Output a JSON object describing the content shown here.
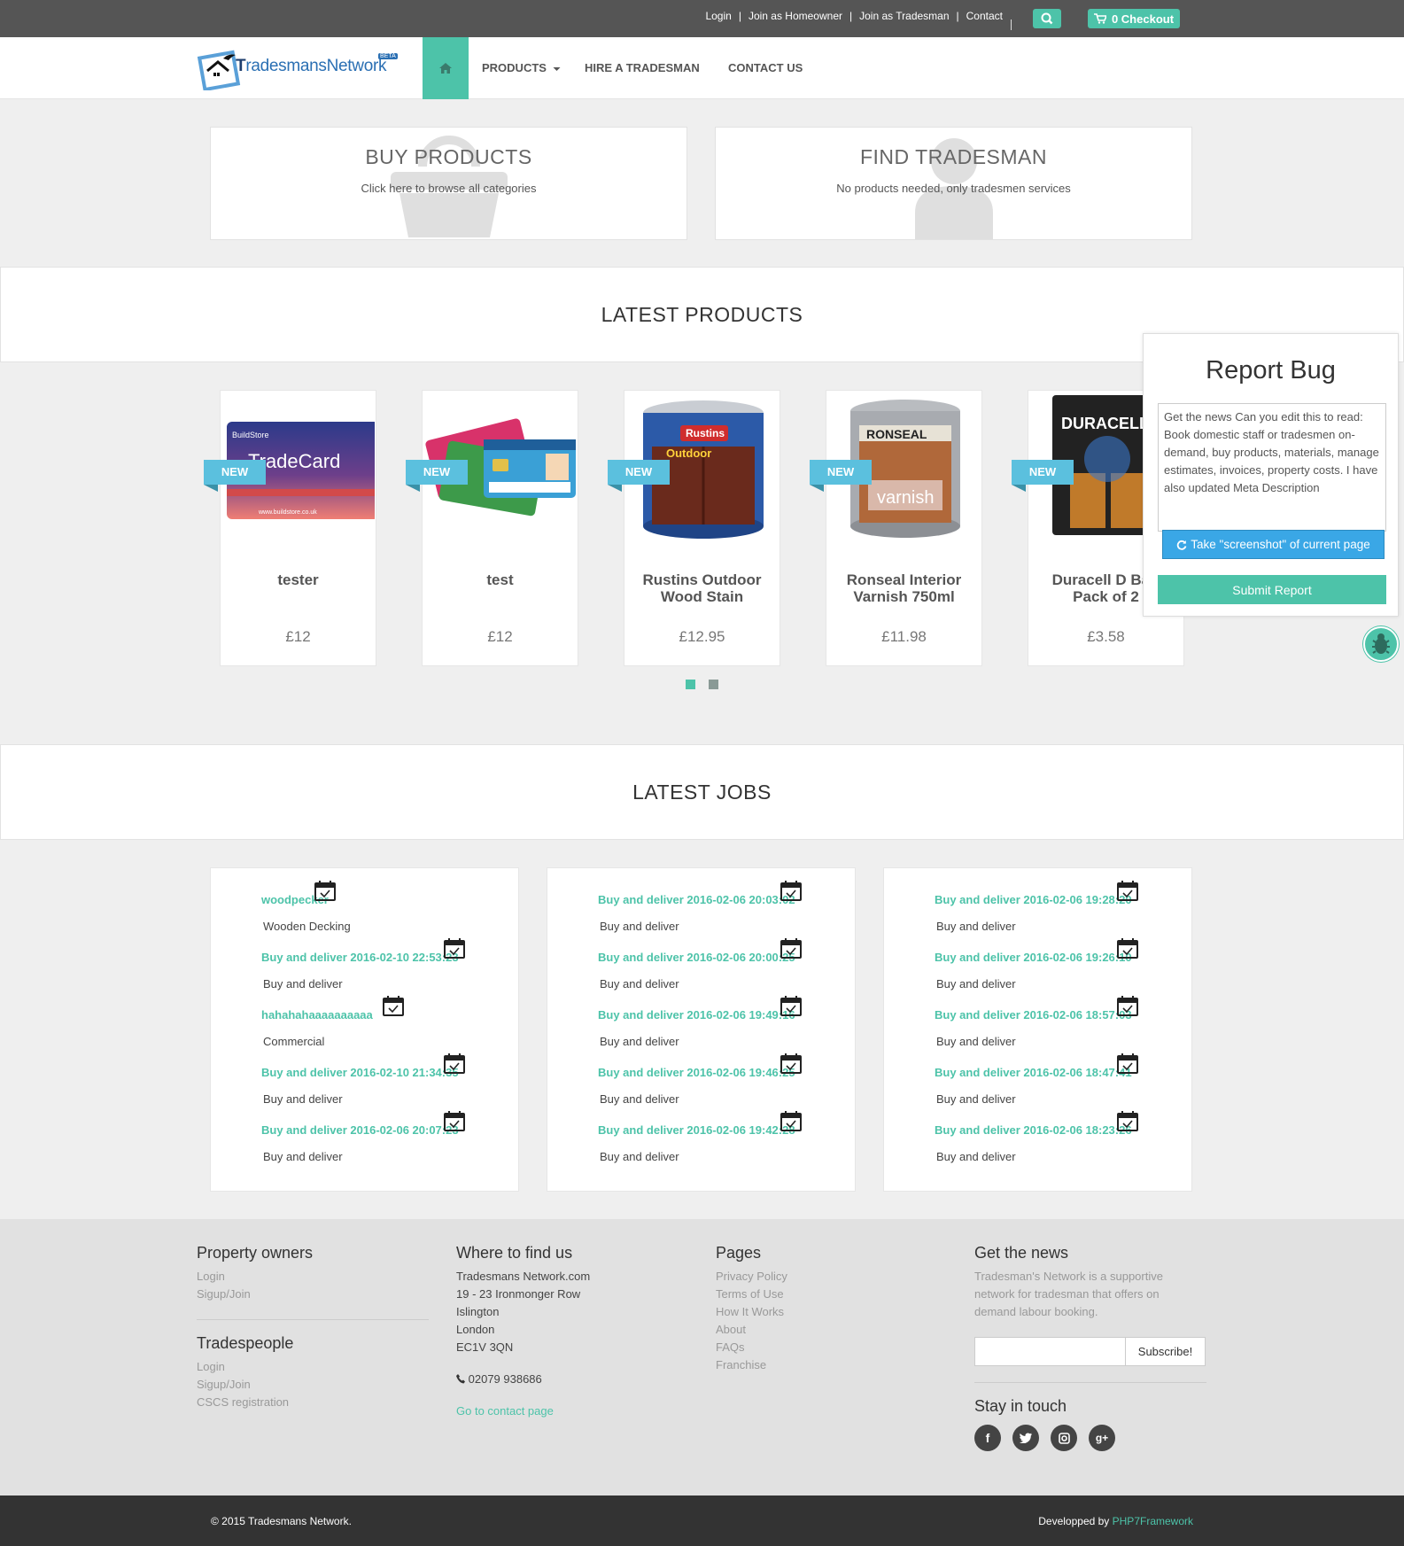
{
  "topbar": {
    "links": [
      "Login",
      "Join as Homeowner",
      "Join as Tradesman",
      "Contact"
    ],
    "checkout_label": "0 Checkout"
  },
  "logo": {
    "text": "radesmansNetwork",
    "badge": "BETA"
  },
  "nav": {
    "products": "PRODUCTS",
    "hire": "HIRE A TRADESMAN",
    "contact": "CONTACT US"
  },
  "hero": {
    "buy": {
      "title": "BUY PRODUCTS",
      "text": "Click here to browse all categories"
    },
    "find": {
      "title": "FIND TRADESMAN",
      "text": "No products needed, only tradesmen services"
    }
  },
  "latest_products": {
    "title": "LATEST PRODUCTS",
    "items": [
      {
        "name": "tester",
        "price": "£12",
        "tag": "NEW",
        "image_text": "TradeCard"
      },
      {
        "name": "test",
        "price": "£12",
        "tag": "NEW",
        "image_text": ""
      },
      {
        "name": "Rustins Outdoor Wood Stain",
        "price": "£12.95",
        "tag": "NEW",
        "image_text": "Rustins"
      },
      {
        "name": "Ronseal Interior Varnish 750ml",
        "price": "£11.98",
        "tag": "NEW",
        "image_text": "RONSEAL"
      },
      {
        "name": "Duracell D Batt Pack of 2",
        "price": "£3.58",
        "tag": "NEW",
        "image_text": "DURACELL"
      }
    ]
  },
  "report_bug": {
    "title": "Report Bug",
    "text": "Get the news Can you edit this to read: Book domestic staff or tradesmen on-demand, buy products, materials, manage estimates, invoices, property costs. I have also updated Meta Description",
    "screenshot_label": "Take \"screenshot\" of current page",
    "submit_label": "Submit Report"
  },
  "latest_jobs": {
    "title": "LATEST JOBS",
    "columns": [
      [
        {
          "title": "woodpecker",
          "desc": "Wooden Decking"
        },
        {
          "title": "Buy and deliver 2016-02-10 22:53:23",
          "desc": "Buy and deliver"
        },
        {
          "title": "hahahahaaaaaaaaaa",
          "desc": "Commercial"
        },
        {
          "title": "Buy and deliver 2016-02-10 21:34:35",
          "desc": "Buy and deliver"
        },
        {
          "title": "Buy and deliver 2016-02-06 20:07:23",
          "desc": "Buy and deliver"
        }
      ],
      [
        {
          "title": "Buy and deliver 2016-02-06 20:03:02",
          "desc": "Buy and deliver"
        },
        {
          "title": "Buy and deliver 2016-02-06 20:00:25",
          "desc": "Buy and deliver"
        },
        {
          "title": "Buy and deliver 2016-02-06 19:49:16",
          "desc": "Buy and deliver"
        },
        {
          "title": "Buy and deliver 2016-02-06 19:46:25",
          "desc": "Buy and deliver"
        },
        {
          "title": "Buy and deliver 2016-02-06 19:42:28",
          "desc": "Buy and deliver"
        }
      ],
      [
        {
          "title": "Buy and deliver 2016-02-06 19:28:20",
          "desc": "Buy and deliver"
        },
        {
          "title": "Buy and deliver 2016-02-06 19:26:10",
          "desc": "Buy and deliver"
        },
        {
          "title": "Buy and deliver 2016-02-06 18:57:03",
          "desc": "Buy and deliver"
        },
        {
          "title": "Buy and deliver 2016-02-06 18:47:41",
          "desc": "Buy and deliver"
        },
        {
          "title": "Buy and deliver 2016-02-06 18:23:26",
          "desc": "Buy and deliver"
        }
      ]
    ]
  },
  "footer": {
    "property_owners": {
      "title": "Property owners",
      "links": [
        "Login",
        "Sigup/Join"
      ]
    },
    "tradespeople": {
      "title": "Tradespeople",
      "links": [
        "Login",
        "Sigup/Join",
        "CSCS registration"
      ]
    },
    "where": {
      "title": "Where to find us",
      "address": [
        "Tradesmans Network.com",
        "19 - 23 Ironmonger Row",
        "Islington",
        "London",
        "EC1V 3QN"
      ],
      "phone": "02079 938686",
      "contact_link": "Go to contact page"
    },
    "pages": {
      "title": "Pages",
      "links": [
        "Privacy Policy",
        "Terms of Use",
        "How It Works",
        "About",
        "FAQs",
        "Franchise"
      ]
    },
    "news": {
      "title": "Get the news",
      "text_lines": [
        "Tradesman's Network is a supportive",
        "network for tradesman that offers on",
        "demand labour booking."
      ],
      "subscribe_label": "Subscribe!"
    },
    "social": {
      "title": "Stay in touch",
      "icons": [
        "facebook-icon",
        "twitter-icon",
        "instagram-icon",
        "google-plus-icon"
      ]
    }
  },
  "bottom": {
    "copyright": "© 2015 Tradesmans Network.",
    "dev_prefix": "Developped by ",
    "dev_link": "PHP7Framework"
  },
  "colors": {
    "accent": "#4dc3a9",
    "tag": "#5bc0de",
    "topbar": "#555555",
    "bottombar": "#333333"
  }
}
